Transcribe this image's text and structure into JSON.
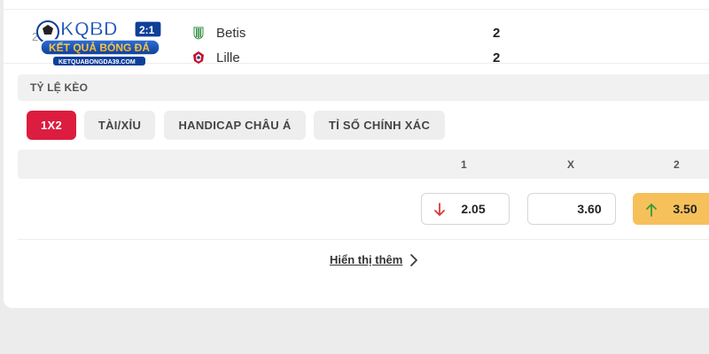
{
  "match": {
    "row_number": "2",
    "home": {
      "name": "Betis",
      "score": "2"
    },
    "away": {
      "name": "Lille",
      "score": "2"
    }
  },
  "logo": {
    "brand": "KQBD",
    "tagline": "KẾT QUẢ BÓNG ĐÁ",
    "url": "KETQUABONGDA39.COM",
    "scoreboard": "2:1"
  },
  "odds": {
    "section_title": "TỶ LỆ KÈO",
    "tabs": [
      {
        "label": "1X2",
        "active": true
      },
      {
        "label": "TÀI/XỈU",
        "active": false
      },
      {
        "label": "HANDICAP CHÂU Á",
        "active": false
      },
      {
        "label": "TỈ SỐ CHÍNH XÁC",
        "active": false
      }
    ],
    "columns": {
      "c1": "1",
      "cx": "X",
      "c2": "2"
    },
    "values": {
      "one": {
        "value": "2.05",
        "trend": "down",
        "trend_icon": "arrow-down-icon"
      },
      "draw": {
        "value": "3.60",
        "trend": "none"
      },
      "two": {
        "value": "3.50",
        "trend": "up",
        "trend_icon": "arrow-up-icon"
      }
    },
    "colors": {
      "active_tab": "#dc1d3f",
      "highlight": "#f6c15a",
      "down": "#d93a3a",
      "up": "#3b9b3b"
    }
  },
  "footer": {
    "show_more": "Hiển thị thêm"
  }
}
